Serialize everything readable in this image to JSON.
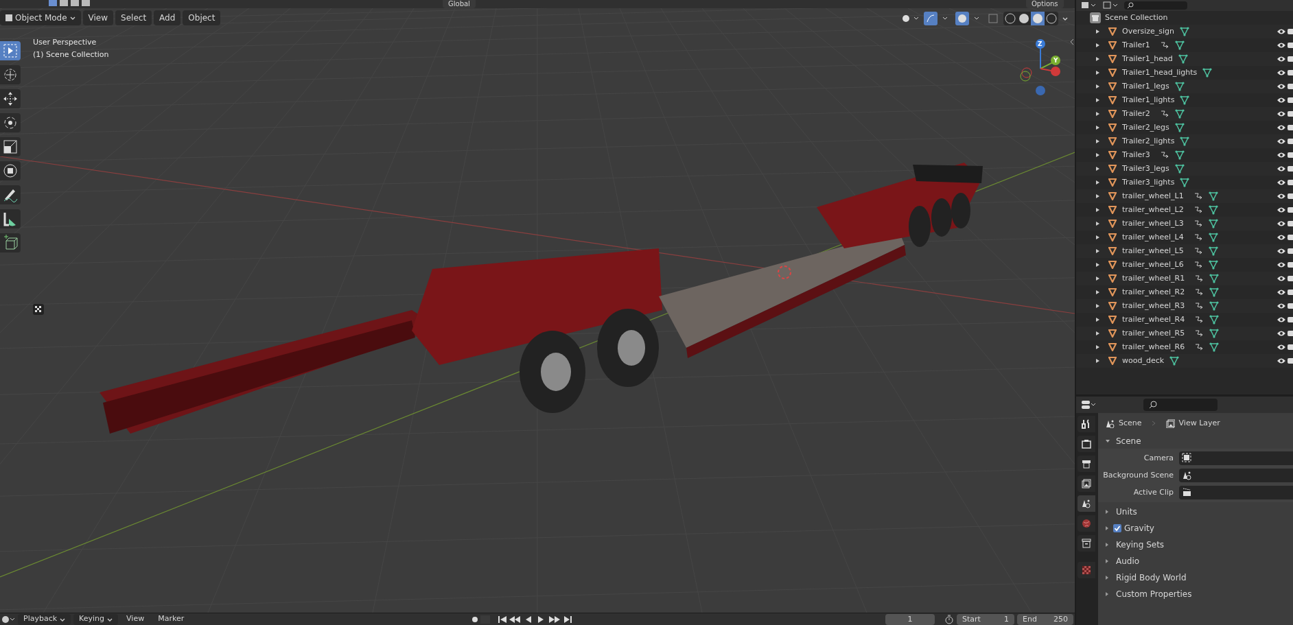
{
  "top_strip": {
    "orientation": "Global",
    "options": "Options"
  },
  "viewport_header": {
    "mode": "Object Mode",
    "menus": [
      "View",
      "Select",
      "Add",
      "Object"
    ]
  },
  "viewport": {
    "view_name": "User Perspective",
    "collection_label": "(1) Scene Collection",
    "gizmo_axes": [
      "Z",
      "Y"
    ]
  },
  "tools": [
    {
      "kind": "select",
      "selected": true
    },
    {
      "kind": "cursor",
      "selected": false
    },
    {
      "kind": "move",
      "selected": false
    },
    {
      "kind": "rotate",
      "selected": false
    },
    {
      "kind": "scale",
      "selected": false
    },
    {
      "kind": "transform",
      "selected": false
    },
    {
      "kind": "annotate",
      "selected": false
    },
    {
      "kind": "measure",
      "selected": false
    },
    {
      "kind": "add_cube",
      "selected": false
    }
  ],
  "outliner": {
    "root": "Scene Collection",
    "items": [
      {
        "name": "Oversize_sign",
        "relation": false
      },
      {
        "name": "Trailer1",
        "relation": true
      },
      {
        "name": "Trailer1_head",
        "relation": false
      },
      {
        "name": "Trailer1_head_lights",
        "relation": false
      },
      {
        "name": "Trailer1_legs",
        "relation": false
      },
      {
        "name": "Trailer1_lights",
        "relation": false
      },
      {
        "name": "Trailer2",
        "relation": true
      },
      {
        "name": "Trailer2_legs",
        "relation": false
      },
      {
        "name": "Trailer2_lights",
        "relation": false
      },
      {
        "name": "Trailer3",
        "relation": true
      },
      {
        "name": "Trailer3_legs",
        "relation": false
      },
      {
        "name": "Trailer3_lights",
        "relation": false
      },
      {
        "name": "trailer_wheel_L1",
        "relation": true
      },
      {
        "name": "trailer_wheel_L2",
        "relation": true
      },
      {
        "name": "trailer_wheel_L3",
        "relation": true
      },
      {
        "name": "trailer_wheel_L4",
        "relation": true
      },
      {
        "name": "trailer_wheel_L5",
        "relation": true
      },
      {
        "name": "trailer_wheel_L6",
        "relation": true
      },
      {
        "name": "trailer_wheel_R1",
        "relation": true
      },
      {
        "name": "trailer_wheel_R2",
        "relation": true
      },
      {
        "name": "trailer_wheel_R3",
        "relation": true
      },
      {
        "name": "trailer_wheel_R4",
        "relation": true
      },
      {
        "name": "trailer_wheel_R5",
        "relation": true
      },
      {
        "name": "trailer_wheel_R6",
        "relation": true
      },
      {
        "name": "wood_deck",
        "relation": false
      }
    ]
  },
  "properties": {
    "tabs": [
      {
        "kind": "tool",
        "selected": false
      },
      {
        "kind": "render",
        "selected": false
      },
      {
        "kind": "output",
        "selected": false
      },
      {
        "kind": "view_layer",
        "selected": false
      },
      {
        "kind": "scene",
        "selected": true
      },
      {
        "kind": "world",
        "selected": false
      },
      {
        "kind": "collection",
        "selected": false
      },
      {
        "kind": "texture",
        "selected": false
      }
    ],
    "breadcrumb": [
      "Scene",
      "View Layer"
    ],
    "panel_title": "Scene",
    "fields": [
      {
        "label": "Camera",
        "kind": "camera"
      },
      {
        "label": "Background Scene",
        "kind": "scene"
      },
      {
        "label": "Active Clip",
        "kind": "clip"
      }
    ],
    "subpanels": [
      {
        "label": "Units",
        "kind": "panel"
      },
      {
        "label": "Gravity",
        "kind": "checkbox",
        "checked": true
      },
      {
        "label": "Keying Sets",
        "kind": "panel"
      },
      {
        "label": "Audio",
        "kind": "panel"
      },
      {
        "label": "Rigid Body World",
        "kind": "panel"
      },
      {
        "label": "Custom Properties",
        "kind": "panel"
      }
    ]
  },
  "timeline": {
    "menus": [
      "Playback",
      "Keying",
      "View",
      "Marker"
    ],
    "current_frame": "1",
    "start_label": "Start",
    "start": "1",
    "end_label": "End",
    "end": "250"
  }
}
